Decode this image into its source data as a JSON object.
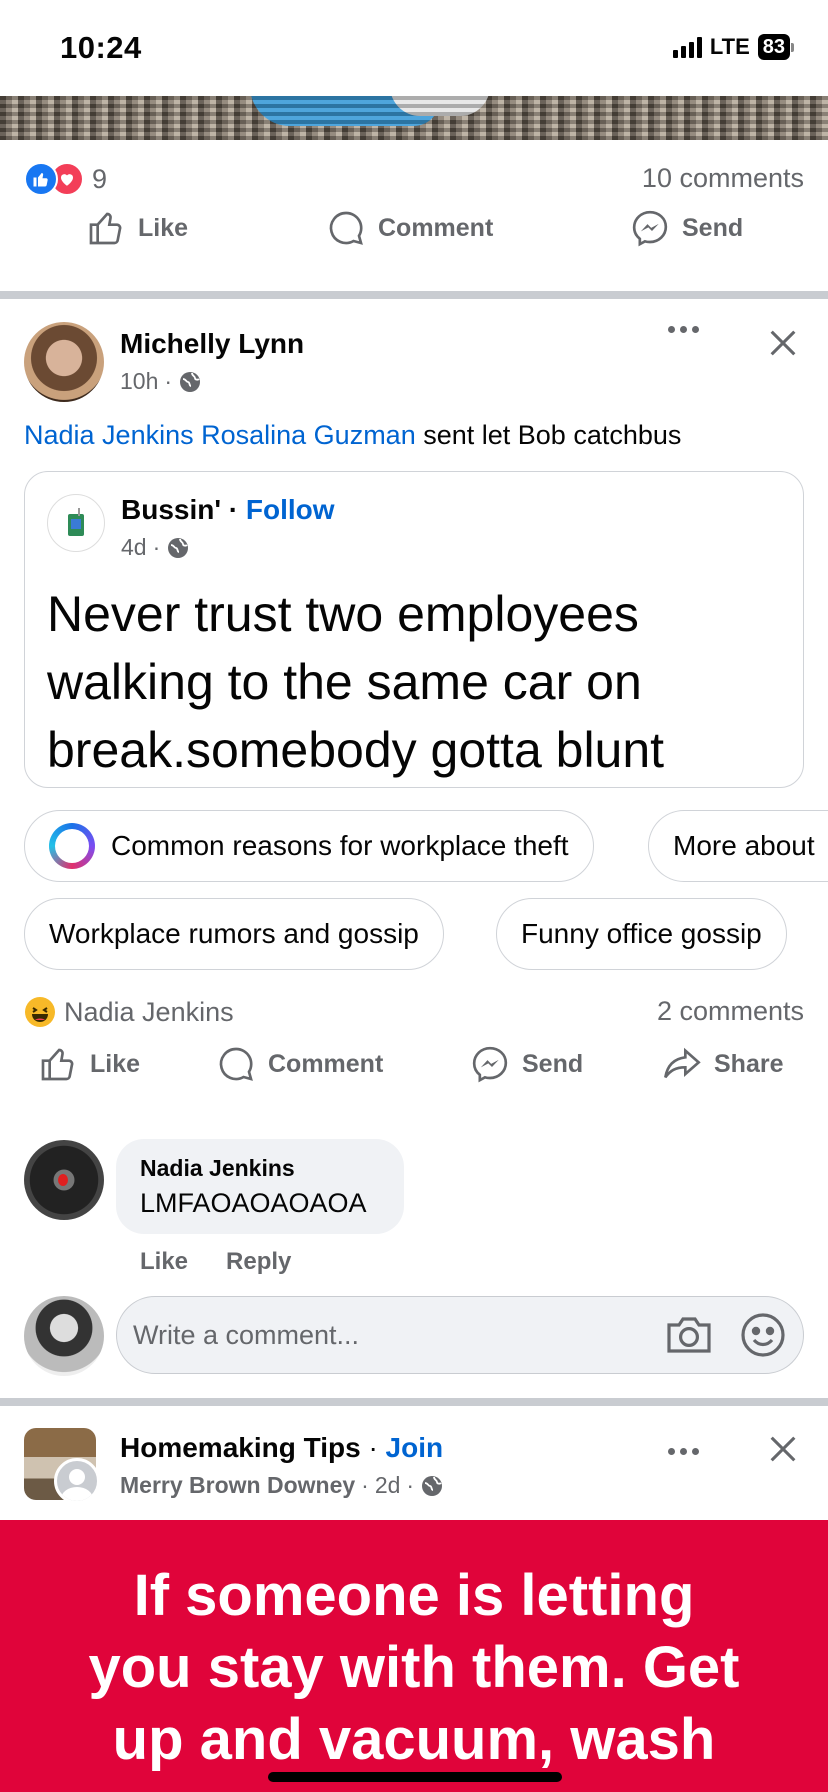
{
  "status_bar": {
    "time": "10:24",
    "network": "LTE",
    "battery": "83"
  },
  "prev_post": {
    "reaction_count": "9",
    "comments": "10 comments",
    "actions": {
      "like": "Like",
      "comment": "Comment",
      "send": "Send"
    }
  },
  "post": {
    "author": "Michelly Lynn",
    "time": "10h",
    "tag1": "Nadia Jenkins",
    "tag2": "Rosalina Guzman",
    "text": " sent let Bob catchbus",
    "shared": {
      "page": "Bussin'",
      "follow": "Follow",
      "time": "4d",
      "body": "Never trust two employees walking to the same car on break.somebody gotta blunt"
    },
    "chips_row1": [
      "Common reasons for workplace theft",
      "More about"
    ],
    "chips_row2": [
      "Workplace rumors and gossip",
      "Funny office gossip"
    ],
    "reactor": "Nadia Jenkins",
    "comments": "2 comments",
    "actions": {
      "like": "Like",
      "comment": "Comment",
      "send": "Send",
      "share": "Share"
    },
    "comment": {
      "author": "Nadia Jenkins",
      "text": "LMFAOAOAOAOA",
      "like": "Like",
      "reply": "Reply"
    },
    "write_placeholder": "Write a comment..."
  },
  "next_post": {
    "group": "Homemaking Tips",
    "join": "Join",
    "author": "Merry Brown Downey",
    "time": "2d",
    "banner_lines": [
      "If someone is letting",
      "you stay with them. Get",
      "up and vacuum, wash"
    ]
  },
  "colors": {
    "accent": "#0064d1",
    "like_blue": "#1877f2",
    "love_red": "#f33e58",
    "banner_red": "#e0043a"
  }
}
